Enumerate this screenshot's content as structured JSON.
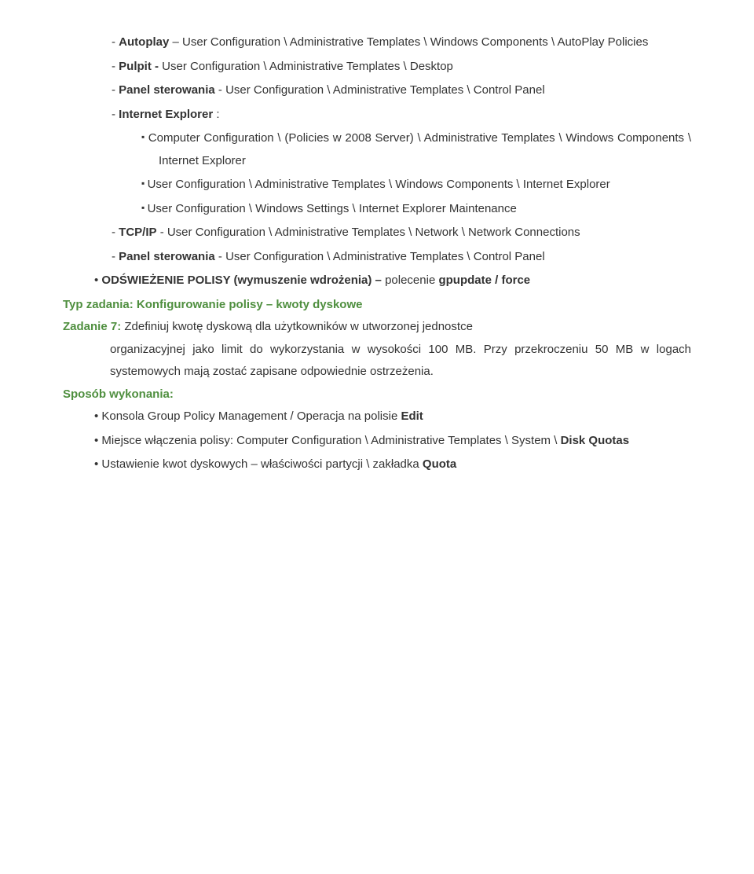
{
  "items": {
    "autoplay": "Autoplay – User Configuration \\ Administrative Templates \\ Windows Components \\ AutoPlay Policies",
    "pulpit": "Pulpit - User Configuration \\ Administrative Templates \\ Desktop",
    "panel1": "Panel sterowania - User Configuration \\ Administrative Templates \\ Control Panel",
    "ie": "Internet Explorer :",
    "ie_sub1": "Computer Configuration \\ (Policies w 2008 Server) \\ Administrative Templates \\ Windows Components \\ Internet Explorer",
    "ie_sub2": "User Configuration \\ Administrative Templates \\ Windows Components \\ Internet Explorer",
    "ie_sub3": "User Configuration \\ Windows Settings \\ Internet Explorer Maintenance",
    "tcpip": "TCP/IP - User Configuration \\ Administrative Templates \\ Network \\ Network Connections",
    "panel2": "Panel sterowania  - User Configuration \\ Administrative Templates \\ Control Panel",
    "odswiez": "ODŚWIEŻENIE POLISY (wymuszenie wdrożenia) – polecenie gpupdate / force",
    "typ": "Typ zadania: Konfigurowanie polisy – kwoty dyskowe",
    "zad7_pre": "Zadanie 7: ",
    "zad7": "Zdefiniuj kwotę dyskową dla użytkowników w utworzonej jednostce organizacyjnej jako limit do wykorzystania w wysokości 100 MB. Przy przekroczeniu 50 MB w logach systemowych mają zostać zapisane odpowiednie ostrzeżenia.",
    "sposob": "Sposób wykonania:",
    "b1_a": "Konsola Group Policy Management / Operacja na polisie ",
    "b1_b": "Edit",
    "b2": "Miejsce włączenia polisy: Computer Configuration \\ Administrative Templates \\ System \\ ",
    "b2_b": "Disk Quotas",
    "b3": "Ustawienie kwot dyskowych – właściwości partycji \\ zakładka ",
    "b3_b": "Quota"
  },
  "bold_words": {
    "autoplay": "Autoplay",
    "pulpit": "Pulpit -",
    "panel": "Panel sterowania",
    "ie": "Internet Explorer",
    "tcpip": "TCP/IP"
  }
}
